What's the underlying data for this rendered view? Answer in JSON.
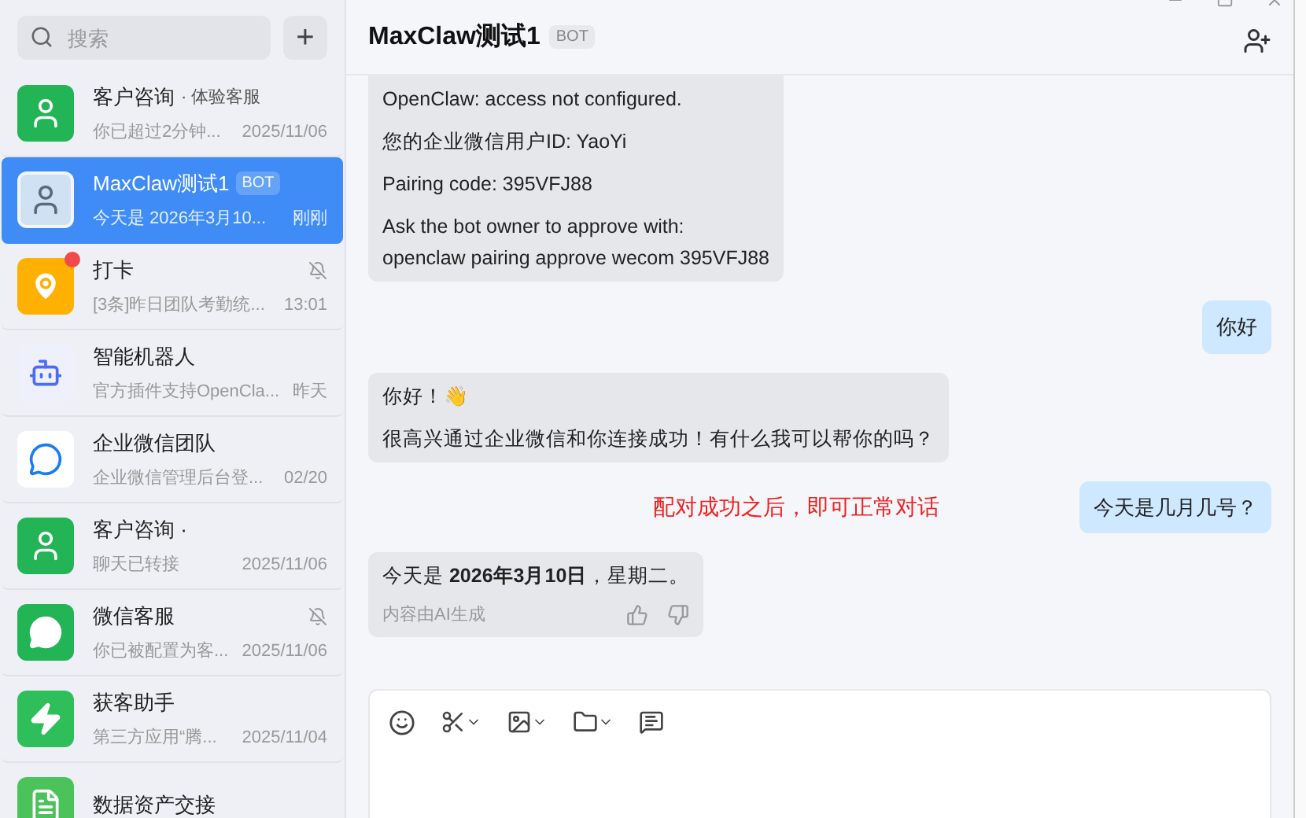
{
  "sidebar": {
    "search": {
      "placeholder": "搜索"
    },
    "add_button": "+",
    "chats": [
      {
        "kind": "person-green",
        "name": "客户咨询",
        "tag": "· 体验客服",
        "preview": "你已超过2分钟...",
        "time": "2025/11/06",
        "muted": false,
        "unread": false,
        "selected": false
      },
      {
        "kind": "photo",
        "name": "MaxClaw测试1",
        "badge": "BOT",
        "preview": "今天是 2026年3月10...",
        "time": "刚刚",
        "muted": false,
        "unread": false,
        "selected": true
      },
      {
        "kind": "pin",
        "name": "打卡",
        "preview": "[3条]昨日团队考勤统...",
        "time": "13:01",
        "muted": true,
        "unread": true,
        "selected": false
      },
      {
        "kind": "robot",
        "name": "智能机器人",
        "preview": "官方插件支持OpenCla...",
        "time": "昨天",
        "muted": false,
        "unread": false,
        "selected": false
      },
      {
        "kind": "wecom",
        "name": "企业微信团队",
        "preview": "企业微信管理后台登...",
        "time": "02/20",
        "muted": false,
        "unread": false,
        "selected": false
      },
      {
        "kind": "person-green",
        "name": "客户咨询 ·",
        "preview": "聊天已转接",
        "time": "2025/11/06",
        "muted": false,
        "unread": false,
        "selected": false
      },
      {
        "kind": "bubble",
        "name": "微信客服",
        "preview": "你已被配置为客...",
        "time": "2025/11/06",
        "muted": true,
        "unread": false,
        "selected": false
      },
      {
        "kind": "bolt",
        "name": "获客助手",
        "preview": "第三方应用“腾...",
        "time": "2025/11/04",
        "muted": false,
        "unread": false,
        "selected": false
      },
      {
        "kind": "doc",
        "name": "数据资产交接",
        "muted": false,
        "unread": false,
        "selected": false
      }
    ]
  },
  "chat": {
    "title": "MaxClaw测试1",
    "badge": "BOT",
    "messages": [
      {
        "kind": "bot",
        "paragraphs": [
          "OpenClaw: access not configured.",
          "您的企业微信用户ID: YaoYi",
          "Pairing code: 395VFJ88",
          "Ask the bot owner to approve with:\nopenclaw pairing approve wecom 395VFJ88"
        ]
      },
      {
        "kind": "user",
        "text": "你好"
      },
      {
        "kind": "bot",
        "paragraphs": [
          "你好！👋",
          "很高兴通过企业微信和你连接成功！有什么我可以帮你的吗？"
        ]
      },
      {
        "kind": "user",
        "text": "今天是几月几号？",
        "note": "配对成功之后，即可正常对话"
      },
      {
        "kind": "bot",
        "paragraphs": [
          "今天是 **2026年3月10日**，星期二。"
        ],
        "footer": "内容由AI生成"
      }
    ]
  }
}
